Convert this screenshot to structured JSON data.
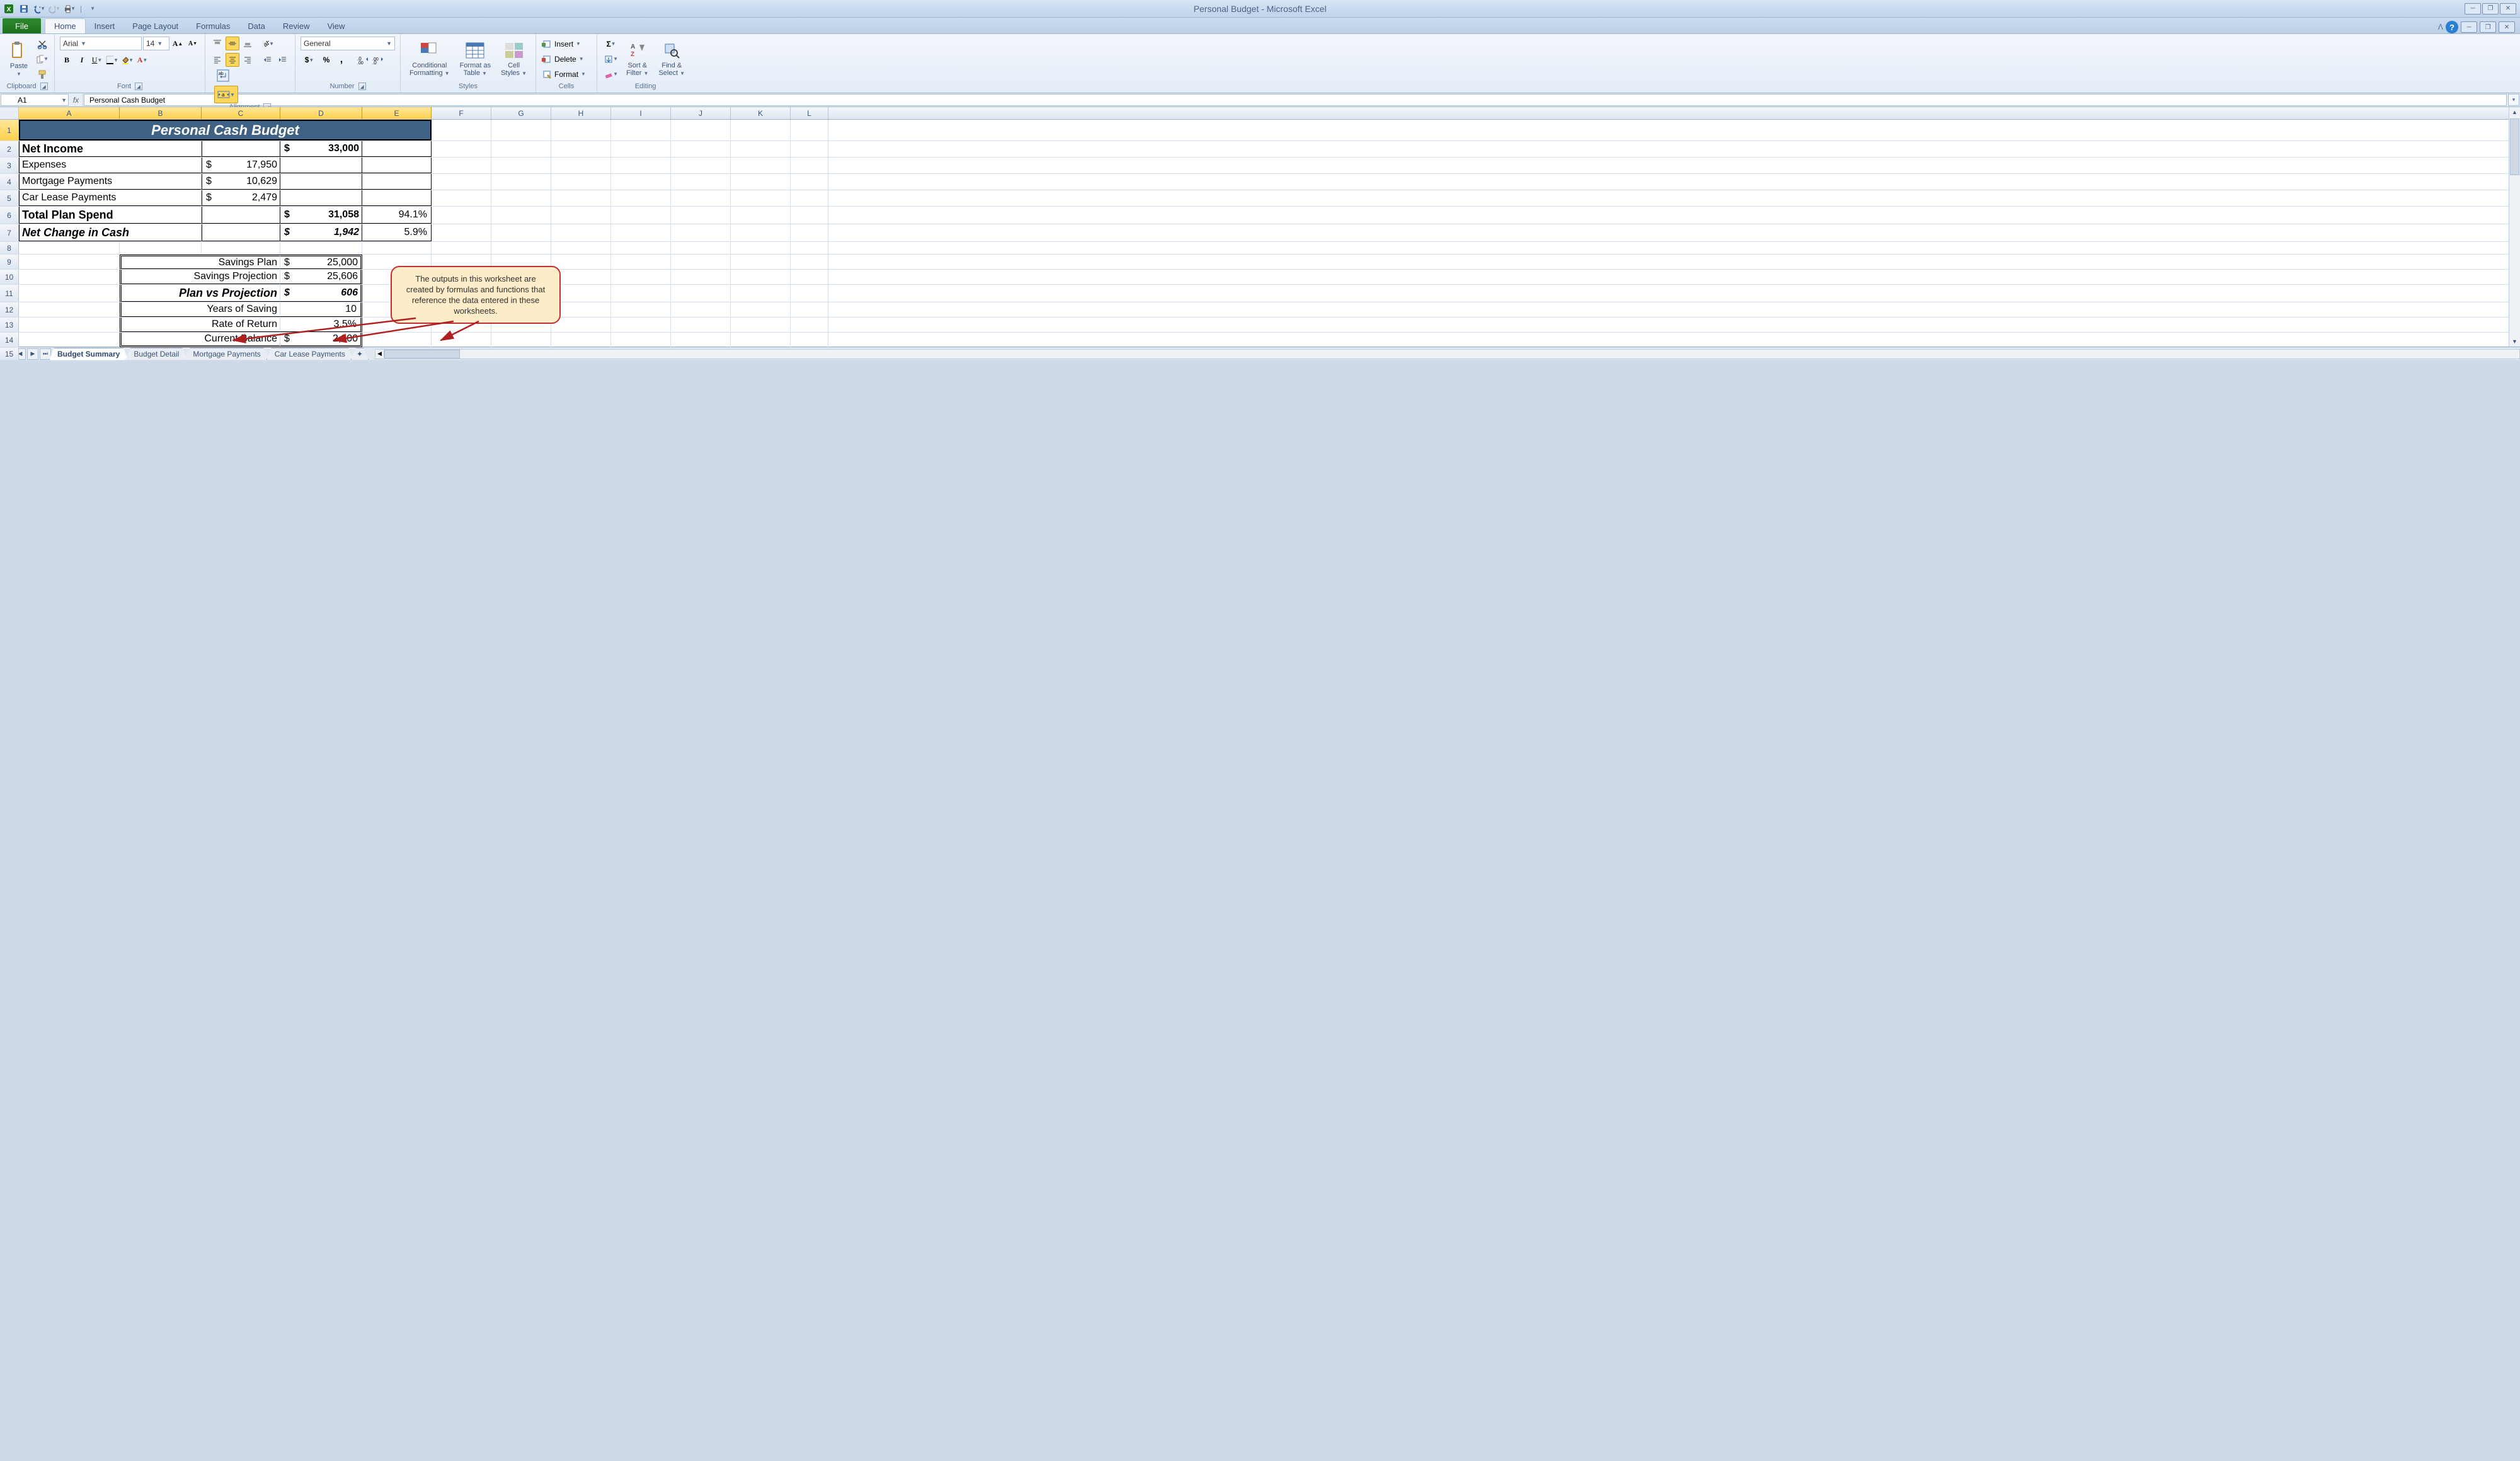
{
  "app_title": "Personal Budget - Microsoft Excel",
  "qat": {
    "save": "save",
    "undo": "undo",
    "redo": "redo",
    "print": "print"
  },
  "tabs": {
    "file": "File",
    "list": [
      "Home",
      "Insert",
      "Page Layout",
      "Formulas",
      "Data",
      "Review",
      "View"
    ],
    "active": "Home"
  },
  "ribbon": {
    "clipboard": {
      "label": "Clipboard",
      "paste": "Paste"
    },
    "font": {
      "label": "Font",
      "name": "Arial",
      "size": "14",
      "bold": "B",
      "italic": "I",
      "underline": "U"
    },
    "alignment": {
      "label": "Alignment"
    },
    "number": {
      "label": "Number",
      "format": "General"
    },
    "styles": {
      "label": "Styles",
      "cond": "Conditional\nFormatting",
      "fmt": "Format as\nTable",
      "cell": "Cell\nStyles"
    },
    "cells": {
      "label": "Cells",
      "insert": "Insert",
      "delete": "Delete",
      "format": "Format"
    },
    "editing": {
      "label": "Editing",
      "sort": "Sort &\nFilter",
      "find": "Find &\nSelect"
    }
  },
  "namebox": "A1",
  "formula": "Personal Cash Budget",
  "columns": [
    "A",
    "B",
    "C",
    "D",
    "E",
    "F",
    "G",
    "H",
    "I",
    "J",
    "K",
    "L"
  ],
  "grid": {
    "r1": {
      "title": "Personal Cash Budget"
    },
    "r2": {
      "a": "Net Income",
      "d_sym": "$",
      "d_val": "33,000"
    },
    "r3": {
      "a": "Expenses",
      "c_sym": "$",
      "c_val": "17,950"
    },
    "r4": {
      "a": "Mortgage Payments",
      "c_sym": "$",
      "c_val": "10,629"
    },
    "r5": {
      "a": "Car Lease Payments",
      "c_sym": "$",
      "c_val": "2,479"
    },
    "r6": {
      "a": "Total Plan Spend",
      "d_sym": "$",
      "d_val": "31,058",
      "e": "94.1%"
    },
    "r7": {
      "a": "Net Change in Cash",
      "d_sym": "$",
      "d_val": "1,942",
      "e": "5.9%"
    },
    "r9": {
      "bc": "Savings Plan",
      "d_sym": "$",
      "d_val": "25,000"
    },
    "r10": {
      "bc": "Savings Projection",
      "d_sym": "$",
      "d_val": "25,606"
    },
    "r11": {
      "bc": "Plan vs Projection",
      "d_sym": "$",
      "d_val": "606"
    },
    "r12": {
      "bc": "Years of Saving",
      "d_val": "10"
    },
    "r13": {
      "bc": "Rate of Return",
      "d_val": "3.5%"
    },
    "r14": {
      "bc": "Current Balance",
      "d_sym": "$",
      "d_val": "2,000"
    }
  },
  "callout": "The outputs in this worksheet are created by formulas and functions that reference the data entered in these worksheets.",
  "sheets": [
    "Budget Summary",
    "Budget Detail",
    "Mortgage Payments",
    "Car Lease Payments"
  ],
  "active_sheet": "Budget Summary"
}
